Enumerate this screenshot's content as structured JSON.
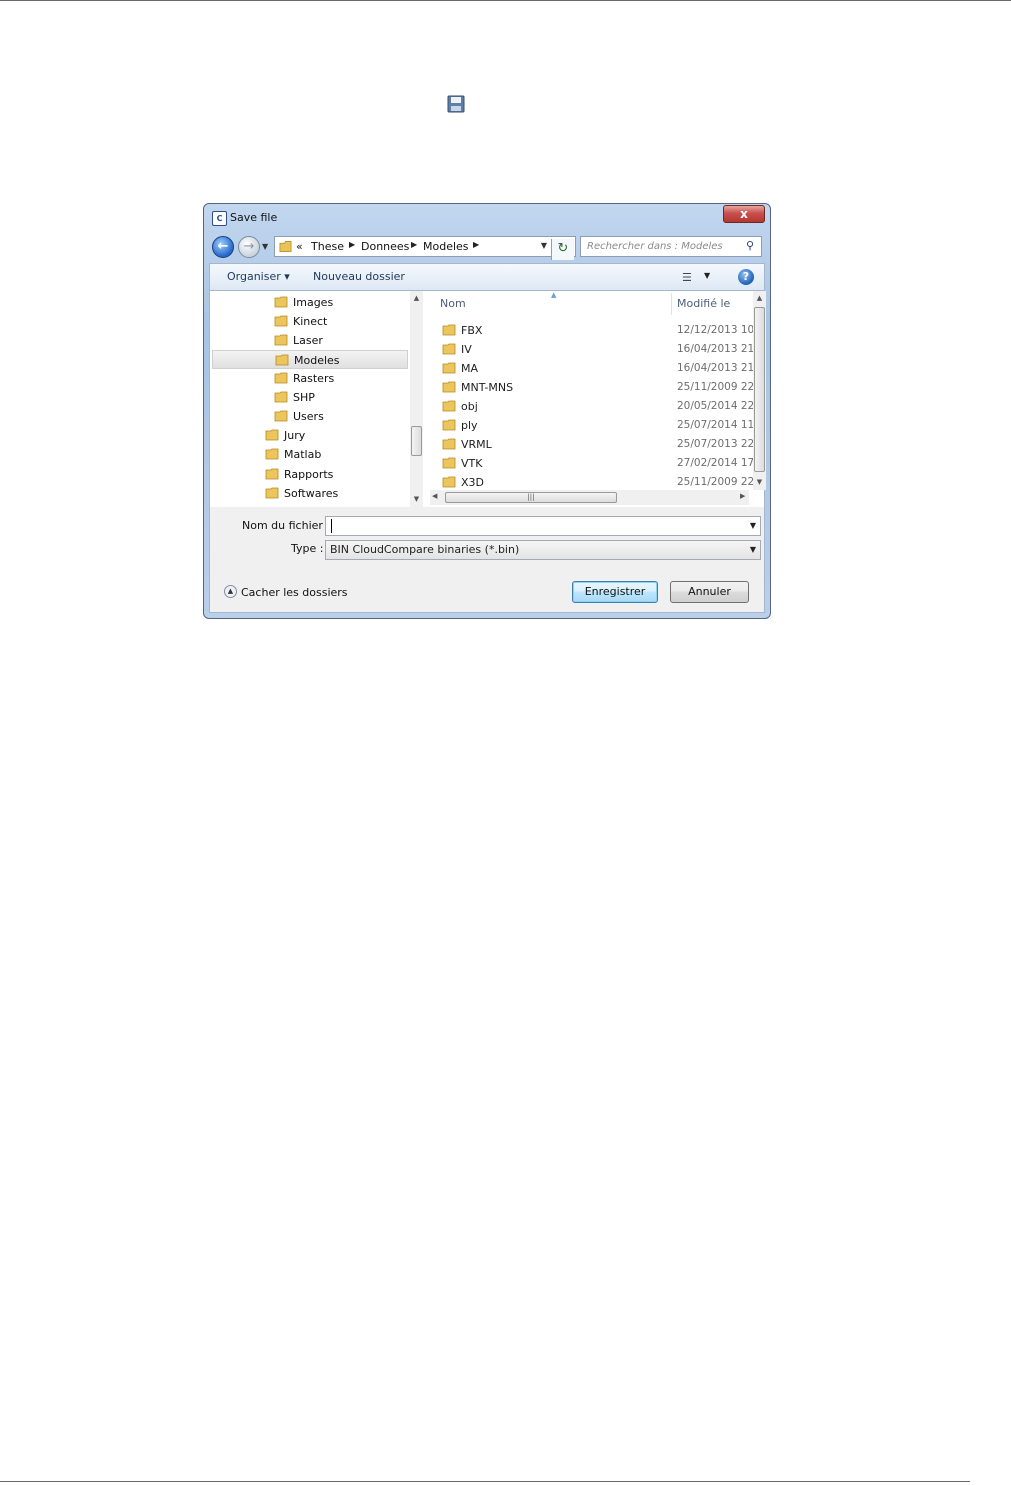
{
  "dialog": {
    "title": "Save file",
    "close_label": "x",
    "app_icon_text": "C"
  },
  "address": {
    "overflow": "«",
    "crumbs": [
      "These",
      "Donnees",
      "Modeles"
    ]
  },
  "search": {
    "placeholder": "Rechercher dans : Modeles"
  },
  "toolbar": {
    "organize_label": "Organiser ▾",
    "new_folder_label": "Nouveau dossier"
  },
  "nav_tree": [
    {
      "label": "Images"
    },
    {
      "label": "Kinect"
    },
    {
      "label": "Laser"
    },
    {
      "label": "Modeles"
    },
    {
      "label": "Rasters"
    },
    {
      "label": "SHP"
    },
    {
      "label": "Users"
    },
    {
      "label": "Jury"
    },
    {
      "label": "Matlab"
    },
    {
      "label": "Rapports"
    },
    {
      "label": "Softwares"
    }
  ],
  "file_list": {
    "columns": [
      "Nom",
      "Modifié le"
    ],
    "rows": [
      {
        "name": "FBX",
        "modified": "12/12/2013 10:"
      },
      {
        "name": "IV",
        "modified": "16/04/2013 21:"
      },
      {
        "name": "MA",
        "modified": "16/04/2013 21:"
      },
      {
        "name": "MNT-MNS",
        "modified": "25/11/2009 22:"
      },
      {
        "name": "obj",
        "modified": "20/05/2014 22:"
      },
      {
        "name": "ply",
        "modified": "25/07/2014 11:"
      },
      {
        "name": "VRML",
        "modified": "25/07/2013 22:"
      },
      {
        "name": "VTK",
        "modified": "27/02/2014 17:"
      },
      {
        "name": "X3D",
        "modified": "25/11/2009 22:"
      }
    ]
  },
  "form": {
    "filename_label": "Nom du fichier :",
    "filename_value": "",
    "type_label": "Type :",
    "type_value": "BIN CloudCompare binaries (*.bin)"
  },
  "footer": {
    "hide_folders_label": "Cacher les dossiers",
    "save_label": "Enregistrer",
    "cancel_label": "Annuler"
  }
}
